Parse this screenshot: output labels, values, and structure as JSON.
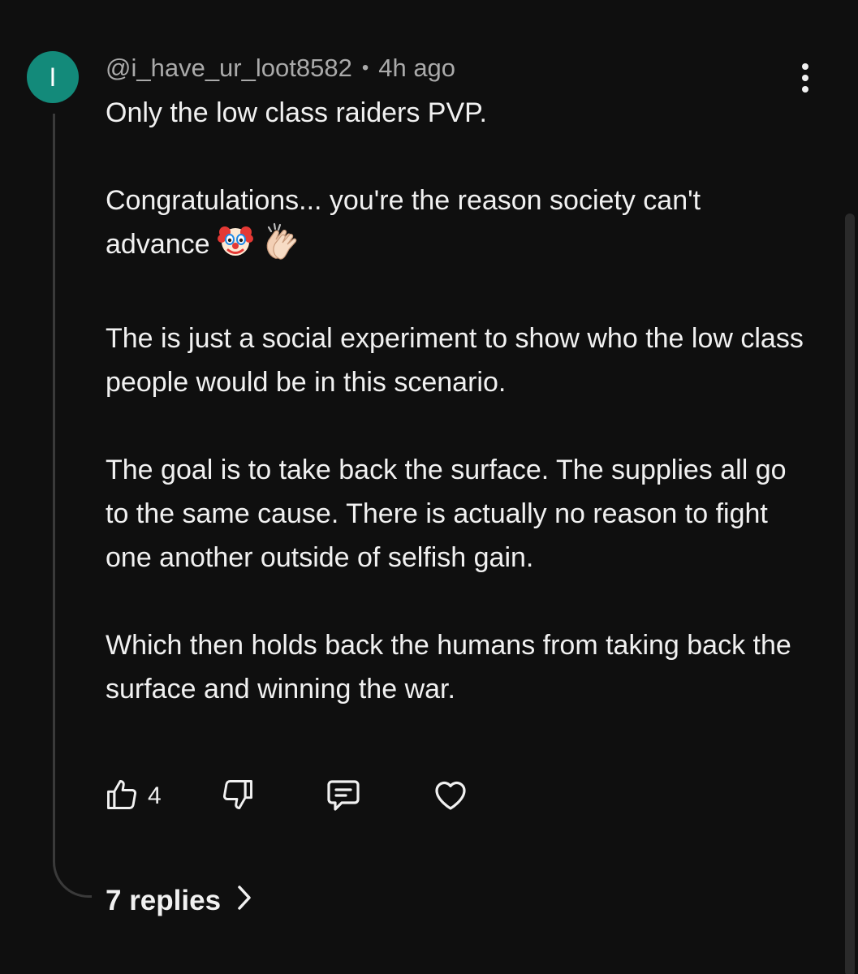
{
  "comment": {
    "avatar_letter": "I",
    "avatar_color": "#138a7a",
    "username": "@i_have_ur_loot8582",
    "separator": "•",
    "timestamp": "4h ago",
    "paragraphs": {
      "p1": "Only the low class raiders PVP.",
      "p2": "Congratulations... you're the reason society can't advance",
      "p3": "The is just a social experiment to show who the low class people would be in this scenario.",
      "p4": "The goal is to take back the surface. The supplies all go to the same cause. There is actually no reason to fight one another outside of selfish gain.",
      "p5": "Which then holds back the humans from taking back the surface and winning the war."
    },
    "emojis": [
      "clown-face",
      "clapping-hands"
    ],
    "like_count": "4",
    "replies_label": "7 replies"
  },
  "icons": {
    "more": "more-vertical-icon",
    "like": "thumbs-up-icon",
    "dislike": "thumbs-down-icon",
    "reply": "reply-comment-icon",
    "heart": "heart-icon",
    "chevron": "chevron-right-icon"
  },
  "colors": {
    "background": "#0f0f0f",
    "text": "#f1f1f1",
    "meta_text": "#aaaaaa",
    "thread_line": "#3a3a3a"
  }
}
